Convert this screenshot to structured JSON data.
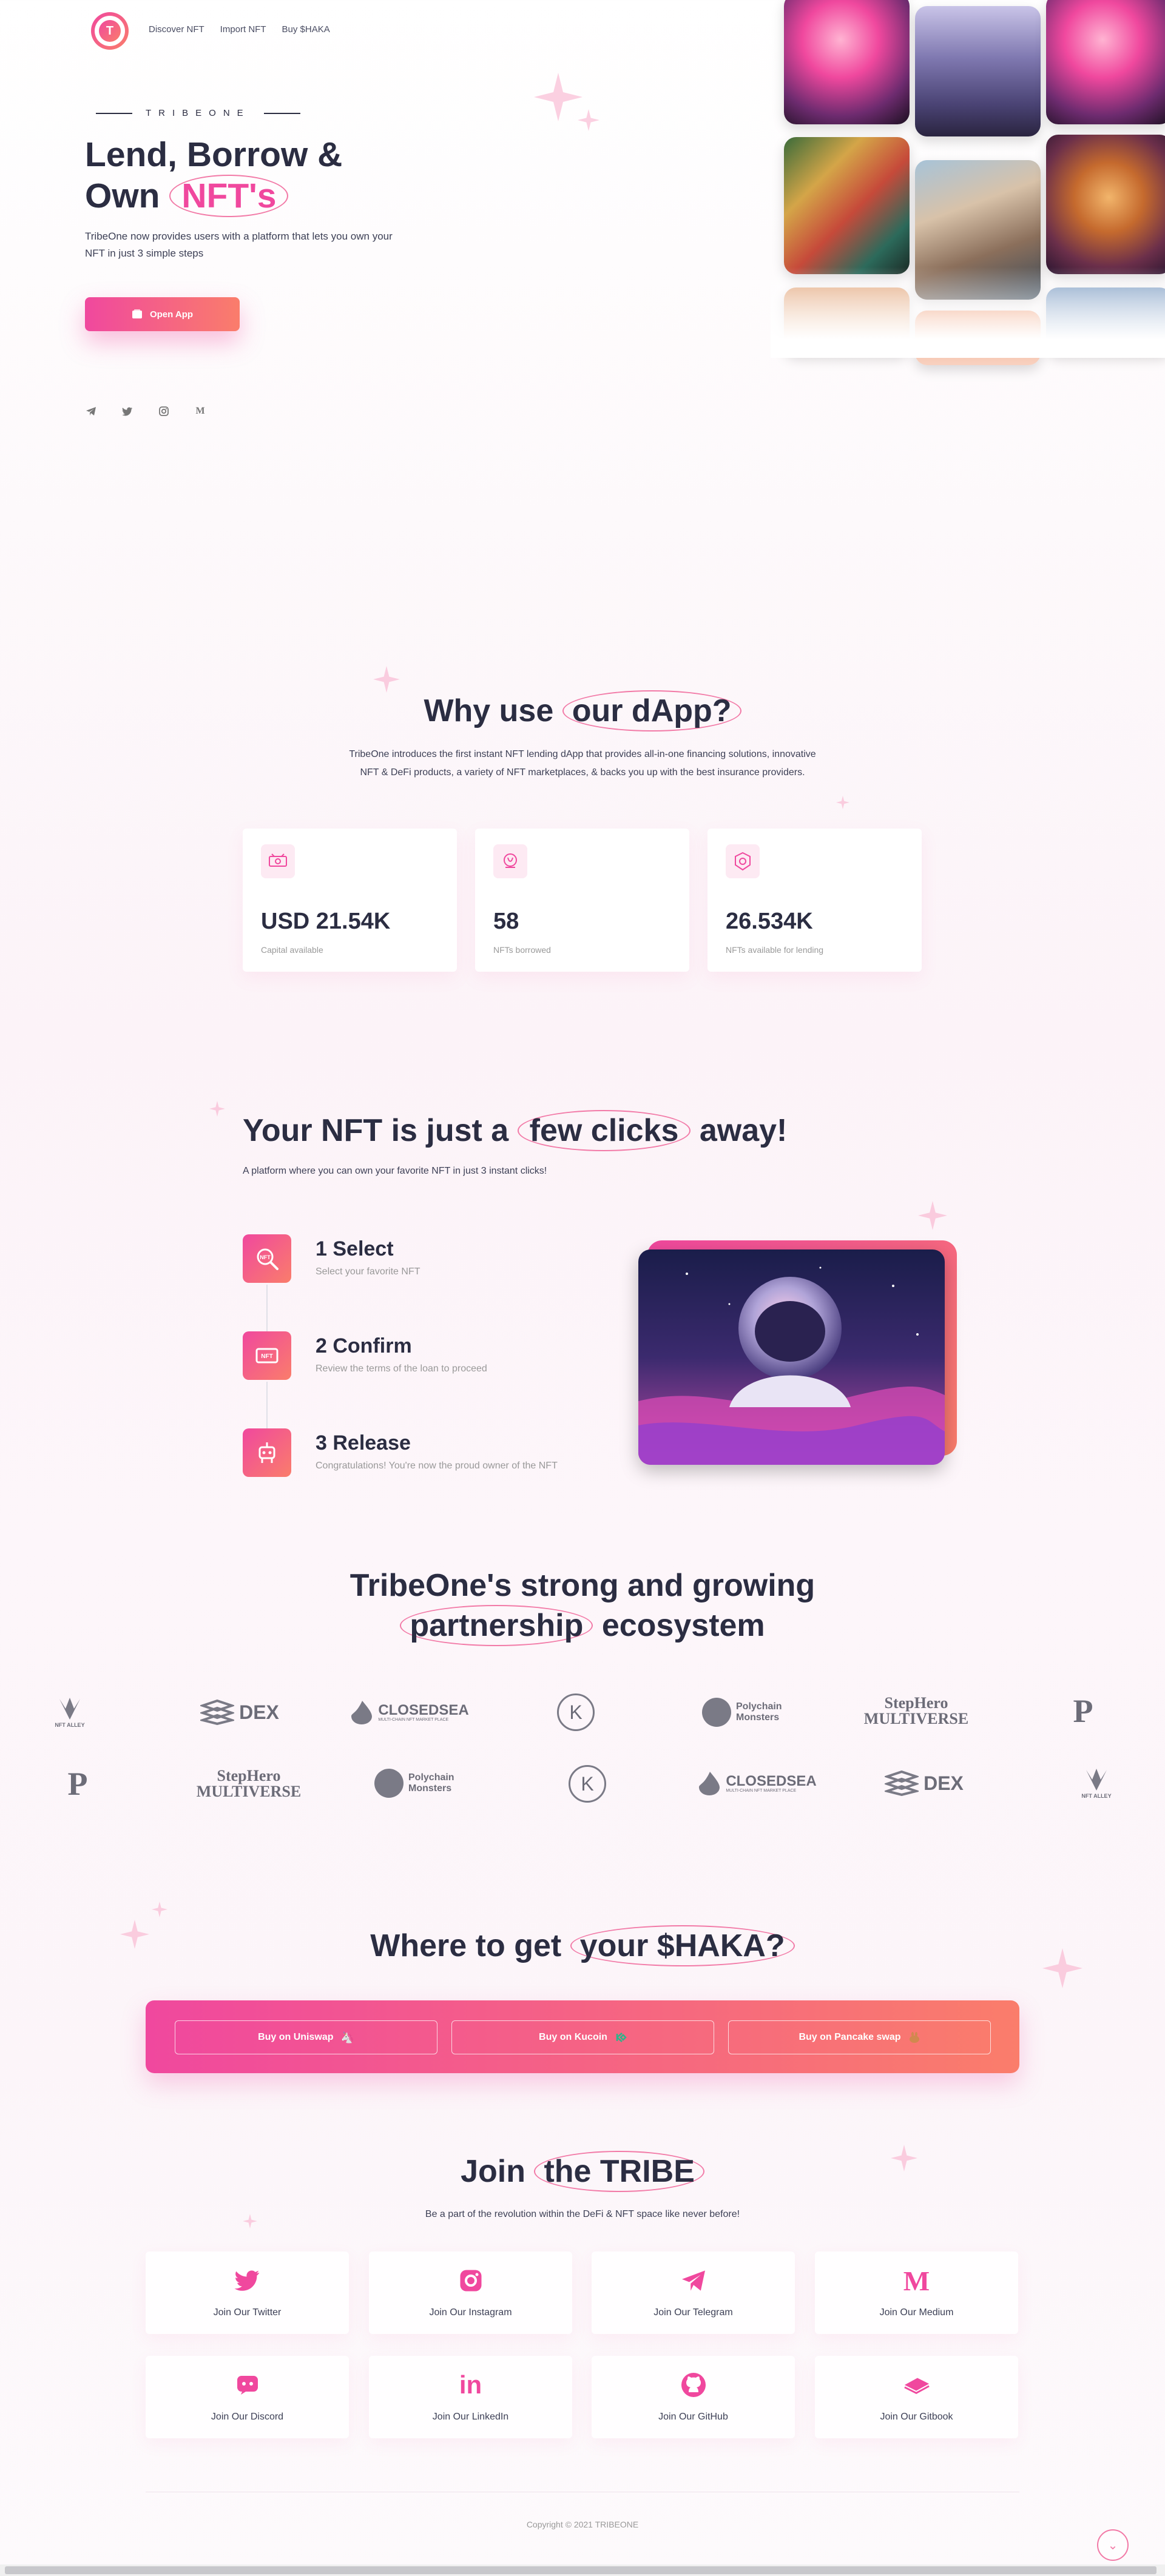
{
  "nav": {
    "logo_mark": "T",
    "items": [
      "Discover NFT",
      "Import NFT",
      "Buy $HAKA"
    ]
  },
  "hero": {
    "brand": "TRIBEONE",
    "title_line1": "Lend, Borrow &",
    "title_line2_plain": "Own",
    "title_line2_highlight": "NFT's",
    "subtitle": "TribeOne now provides users with a platform that lets you own your NFT in just 3 simple steps",
    "cta_label": "Open App",
    "social_icons": [
      "telegram-icon",
      "twitter-icon",
      "instagram-icon",
      "medium-icon"
    ]
  },
  "why": {
    "title_plain": "Why use",
    "title_highlight": "our dApp?",
    "subtitle_line1": "TribeOne introduces the first instant NFT lending dApp that provides all-in-one financing solutions, innovative",
    "subtitle_line2": "NFT & DeFi products, a variety of NFT marketplaces, & backs you up with the best insurance providers.",
    "stats": [
      {
        "value": "USD 21.54K",
        "label": "Capital available",
        "icon": "capital-icon"
      },
      {
        "value": "58",
        "label": "NFTs borrowed",
        "icon": "borrowed-icon"
      },
      {
        "value": "26.534K",
        "label": "NFTs available for lending",
        "icon": "lending-icon"
      }
    ]
  },
  "clicks": {
    "title_plain_1": "Your NFT is just a",
    "title_highlight": "few clicks",
    "title_plain_2": "away!",
    "subtitle": "A platform where you can own your favorite NFT in just 3 instant clicks!",
    "steps": [
      {
        "title": "1 Select",
        "desc": "Select your favorite NFT",
        "icon": "select-search-icon"
      },
      {
        "title": "2 Confirm",
        "desc": "Review the terms of the loan to proceed",
        "icon": "confirm-nft-icon"
      },
      {
        "title": "3 Release",
        "desc": "Congratulations! You're now the proud owner of the NFT",
        "icon": "release-robot-icon"
      }
    ]
  },
  "partners": {
    "title_line1": "TribeOne's strong and growing",
    "title_highlight": "partnership",
    "title_plain": "ecosystem",
    "row1": [
      "NFT ALLEY",
      "DEX",
      "CLOSEDSEA",
      "K",
      "Polychain Monsters",
      "StepHero MULTIVERSE",
      "P"
    ],
    "row2": [
      "P",
      "StepHero MULTIVERSE",
      "Polychain Monsters",
      "K",
      "CLOSEDSEA",
      "DEX",
      "NFT ALLEY"
    ],
    "closedsea_sub": "MULTI-CHAIN NFT MARKET PLACE"
  },
  "haka": {
    "title_plain": "Where to get",
    "title_highlight": "your $HAKA?",
    "buttons": [
      "Buy on Uniswap",
      "Buy on Kucoin",
      "Buy on Pancake swap"
    ]
  },
  "join": {
    "title_plain": "Join",
    "title_highlight": "the TRIBE",
    "subtitle": "Be a part of the revolution within the DeFi & NFT space like never before!",
    "cards": [
      {
        "label": "Join Our Twitter",
        "icon": "twitter-icon"
      },
      {
        "label": "Join Our Instagram",
        "icon": "instagram-icon"
      },
      {
        "label": "Join Our Telegram",
        "icon": "telegram-icon"
      },
      {
        "label": "Join Our Medium",
        "icon": "medium-icon"
      },
      {
        "label": "Join Our Discord",
        "icon": "discord-icon"
      },
      {
        "label": "Join Our LinkedIn",
        "icon": "linkedin-icon"
      },
      {
        "label": "Join Our GitHub",
        "icon": "github-icon"
      },
      {
        "label": "Join Our Gitbook",
        "icon": "gitbook-icon"
      }
    ]
  },
  "footer": {
    "copyright": "Copyright © 2021 TRIBEONE",
    "scroll_top_glyph": "⌄"
  },
  "colors": {
    "accent_pink": "#f0489e",
    "accent_coral": "#fa7d6b",
    "text_dark": "#2b2d42"
  }
}
